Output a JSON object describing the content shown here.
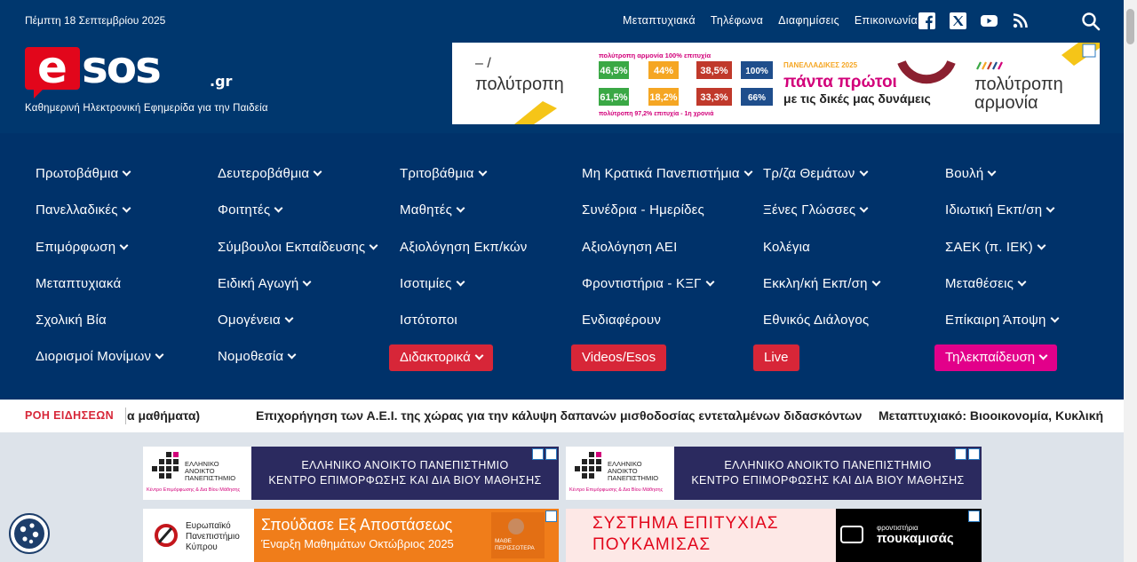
{
  "header": {
    "date": "Πέμπτη 18 Σεπτεμβρίου 2025",
    "top_links": [
      "Μεταπτυχιακά",
      "Τηλέφωνα",
      "Διαφημίσεις",
      "Επικοινωνία"
    ],
    "social_icons": [
      "facebook-icon",
      "x-twitter-icon",
      "youtube-icon",
      "rss-icon"
    ],
    "logo_text": "esos",
    "logo_tld": ".gr",
    "tagline": "Καθημερινή Ηλεκτρονική Εφημερίδα για την Παιδεία"
  },
  "top_ad": {
    "brand_left": "πολύτροπη",
    "headline_top": "πολύτροπη αρμονία 100% επιτυχία",
    "stats_row1": [
      "46,5%",
      "44%",
      "38,5%",
      "100%"
    ],
    "stats_row2": [
      "61,5%",
      "18,2%",
      "33,3%",
      "66%"
    ],
    "footer": "πολύτροπη 97,2% επιτυχία - 1η χρονιά",
    "campaign_small": "ΠΑΝΕΛΛΑΔΙΚΕΣ 2025",
    "campaign_big": "πάντα πρώτοι",
    "campaign_sub": "με τις δικές μας δυνάμεις",
    "brand_right_1": "πολύτροπη",
    "brand_right_2": "αρμονία",
    "colors": {
      "green": "#3aa845",
      "orange": "#f5a623",
      "red": "#c0392b",
      "blue": "#1f4e8c",
      "magenta": "#d2007a"
    }
  },
  "menu": {
    "columns": [
      [
        {
          "label": "Πρωτοβάθμια",
          "dropdown": true
        },
        {
          "label": "Πανελλαδικές",
          "dropdown": true
        },
        {
          "label": "Επιμόρφωση",
          "dropdown": true
        },
        {
          "label": "Μεταπτυχιακά",
          "dropdown": false
        },
        {
          "label": "Σχολική Βία",
          "dropdown": false
        },
        {
          "label": "Διορισμοί Μονίμων",
          "dropdown": true
        }
      ],
      [
        {
          "label": "Δευτεροβάθμια",
          "dropdown": true
        },
        {
          "label": "Φοιτητές",
          "dropdown": true
        },
        {
          "label": "Σύμβουλοι Εκπαίδευσης",
          "dropdown": true
        },
        {
          "label": "Ειδική Αγωγή",
          "dropdown": true
        },
        {
          "label": "Ομογένεια",
          "dropdown": true
        },
        {
          "label": "Νομοθεσία",
          "dropdown": true
        }
      ],
      [
        {
          "label": "Τριτοβάθμια",
          "dropdown": true
        },
        {
          "label": "Μαθητές",
          "dropdown": true
        },
        {
          "label": "Αξιολόγηση Εκπ/κών",
          "dropdown": false
        },
        {
          "label": "Ισοτιμίες",
          "dropdown": true
        },
        {
          "label": "Ιστότοποι",
          "dropdown": false
        },
        {
          "label": "Διδακτορικά",
          "dropdown": true,
          "pill": "red"
        }
      ],
      [
        {
          "label": "Μη Κρατικά Πανεπιστήμια",
          "dropdown": true
        },
        {
          "label": "Συνέδρια - Ημερίδες",
          "dropdown": false
        },
        {
          "label": "Αξιολόγηση ΑΕΙ",
          "dropdown": false
        },
        {
          "label": "Φροντιστήρια - ΚΞΓ",
          "dropdown": true
        },
        {
          "label": "Ενδιαφέρουν",
          "dropdown": false
        },
        {
          "label": "Videos/Esos",
          "dropdown": false,
          "pill": "red"
        }
      ],
      [
        {
          "label": "Τρ/ζα Θεμάτων",
          "dropdown": true
        },
        {
          "label": "Ξένες Γλώσσες",
          "dropdown": true
        },
        {
          "label": "Κολέγια",
          "dropdown": false
        },
        {
          "label": "Εκκλη/κή Εκπ/ση",
          "dropdown": true
        },
        {
          "label": "Εθνικός Διάλογος",
          "dropdown": false
        },
        {
          "label": "Live",
          "dropdown": false,
          "pill": "red"
        }
      ],
      [
        {
          "label": "Βουλή",
          "dropdown": true
        },
        {
          "label": "Ιδιωτική Εκπ/ση",
          "dropdown": true
        },
        {
          "label": "ΣΑΕΚ (π. ΙΕΚ)",
          "dropdown": true
        },
        {
          "label": "Μεταθέσεις",
          "dropdown": true
        },
        {
          "label": "Επίκαιρη Άποψη",
          "dropdown": true
        },
        {
          "label": "Τηλεκπαίδευση",
          "dropdown": true,
          "pill": "magenta"
        }
      ]
    ]
  },
  "ticker": {
    "label": "ΡΟΗ ΕΙΔΗΣΕΩΝ",
    "items": [
      "α μαθήματα)",
      "Επιχορήγηση των Α.Ε.Ι. της χώρας για την κάλυψη δαπανών μισθοδοσίας εντεταλμένων διδασκόντων",
      "Μεταπτυχιακό: Βιοοικονομία, Κυκλική"
    ]
  },
  "ads": {
    "eap": {
      "logo_line1": "ΕΛΛΗΝΙΚΟ",
      "logo_line2": "ΑΝΟΙΚΤΟ",
      "logo_line3": "ΠΑΝΕΠΙΣΤΗΜΙΟ",
      "logo_sub": "Κέντρο Επιμόρφωσης & Δια Βίου Μάθησης",
      "line1": "ΕΛΛΗΝΙΚΟ ΑΝΟΙΚΤΟ ΠΑΝΕΠΙΣΤΗΜΙΟ",
      "line2": "ΚΕΝΤΡΟ ΕΠΙΜΟΡΦΩΣΗΣ ΚΑΙ ΔΙΑ ΒΙΟΥ ΜΑΘΗΣΗΣ"
    },
    "euc": {
      "logo_line1": "Ευρωπαϊκό",
      "logo_line2": "Πανεπιστήμιο",
      "logo_line3": "Κύπρου",
      "headline": "Σπούδασε Εξ Αποστάσεως",
      "subline": "Έναρξη Μαθημάτων Οκτώβριος 2025",
      "cta_line1": "ΜΑΘΕ",
      "cta_line2": "ΠΕΡΙΣΣΟΤΕΡΑ"
    },
    "poukamisas": {
      "headline_1": "ΣΥΣΤΗΜΑ ΕΠΙΤΥΧΙΑΣ",
      "headline_2": "ΠΟΥΚΑΜΙΣΑΣ",
      "brand_small": "φροντιστήρια",
      "brand_big": "πουκαμισάς"
    }
  }
}
